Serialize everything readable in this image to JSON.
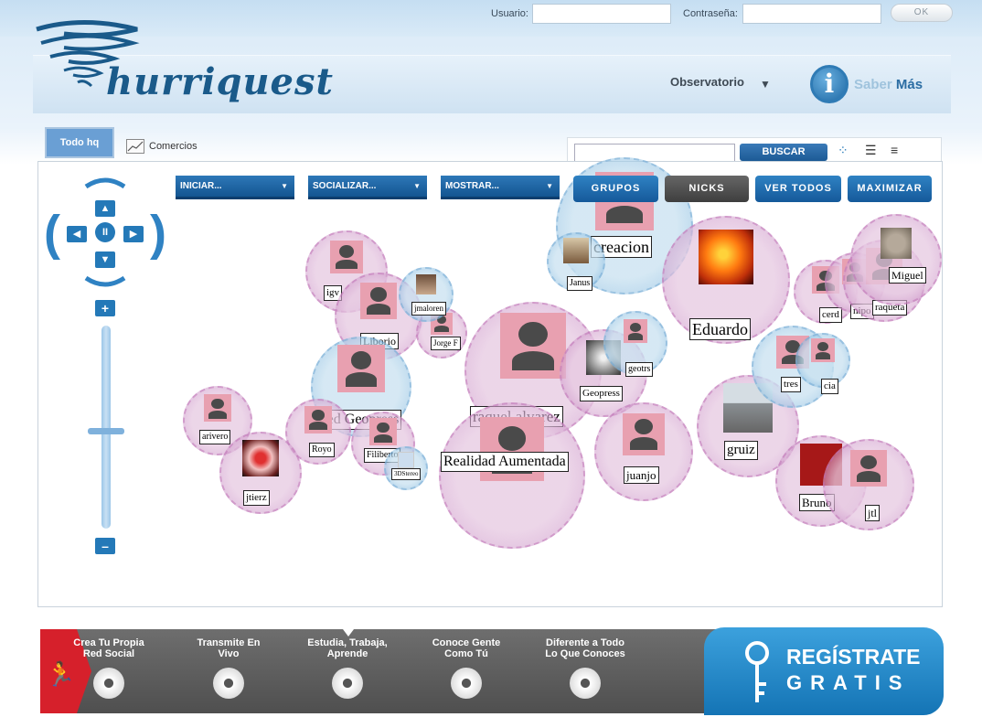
{
  "login": {
    "user_label": "Usuario:",
    "pass_label": "Contraseña:",
    "user_value": "",
    "pass_value": "",
    "ok_label": "OK"
  },
  "header": {
    "logo_text": "hurriquest",
    "observatorio": "Observatorio",
    "saber_a": "Saber",
    "saber_b": "Más"
  },
  "tabs": [
    {
      "label": "Todo hq",
      "active": true
    },
    {
      "label": "Comercios",
      "active": false
    }
  ],
  "search": {
    "value": "",
    "button": "BUSCAR"
  },
  "menus": [
    {
      "label": "INICIAR..."
    },
    {
      "label": "SOCIALIZAR..."
    },
    {
      "label": "MOSTRAR..."
    }
  ],
  "buttons": [
    {
      "label": "GRUPOS",
      "dark": false
    },
    {
      "label": "NICKS",
      "dark": true
    },
    {
      "label": "VER TODOS",
      "dark": false
    },
    {
      "label": "MAXIMIZAR",
      "dark": false
    }
  ],
  "bubbles": [
    {
      "name": "igv",
      "color": "pink"
    },
    {
      "name": "Liborio",
      "color": "pink"
    },
    {
      "name": "Jorge F",
      "color": "pink"
    },
    {
      "name": "jmaloren",
      "color": "blue"
    },
    {
      "name": "creacion",
      "color": "blue"
    },
    {
      "name": "Janus",
      "color": "blue"
    },
    {
      "name": "Eduardo",
      "color": "pink"
    },
    {
      "name": "cerd",
      "color": "pink"
    },
    {
      "name": "nipo",
      "color": "pink"
    },
    {
      "name": "raqueta",
      "color": "pink"
    },
    {
      "name": "Miguel",
      "color": "pink"
    },
    {
      "name": "Red Geopress",
      "color": "blue"
    },
    {
      "name": "raquel.alvarez",
      "color": "pink"
    },
    {
      "name": "Geopress",
      "color": "pink"
    },
    {
      "name": "geotrs",
      "color": "blue"
    },
    {
      "name": "Realidad Aumentada",
      "color": "pink"
    },
    {
      "name": "juanjo",
      "color": "pink"
    },
    {
      "name": "gruiz",
      "color": "pink"
    },
    {
      "name": "tres",
      "color": "blue"
    },
    {
      "name": "cia",
      "color": "blue"
    },
    {
      "name": "Bruno",
      "color": "pink"
    },
    {
      "name": "jtl",
      "color": "pink"
    },
    {
      "name": "arivero",
      "color": "pink"
    },
    {
      "name": "Royo",
      "color": "pink"
    },
    {
      "name": "Filiberto",
      "color": "pink"
    },
    {
      "name": "3DStereo",
      "color": "blue"
    },
    {
      "name": "jtierz",
      "color": "pink"
    }
  ],
  "features": [
    {
      "l1": "Crea Tu Propia",
      "l2": "Red Social"
    },
    {
      "l1": "Transmite En",
      "l2": "Vivo"
    },
    {
      "l1": "Estudia, Trabaja,",
      "l2": "Aprende"
    },
    {
      "l1": "Conoce Gente",
      "l2": "Como Tú"
    },
    {
      "l1": "Diferente a Todo",
      "l2": "Lo Que Conoces"
    }
  ],
  "register": {
    "line1": "REGÍSTRATE",
    "line2": "GRATIS"
  },
  "colors": {
    "accent": "#2479b8",
    "brand_red": "#d6202b",
    "bubble_pink": "#e6c8e1",
    "bubble_blue": "#c8e1f0"
  }
}
